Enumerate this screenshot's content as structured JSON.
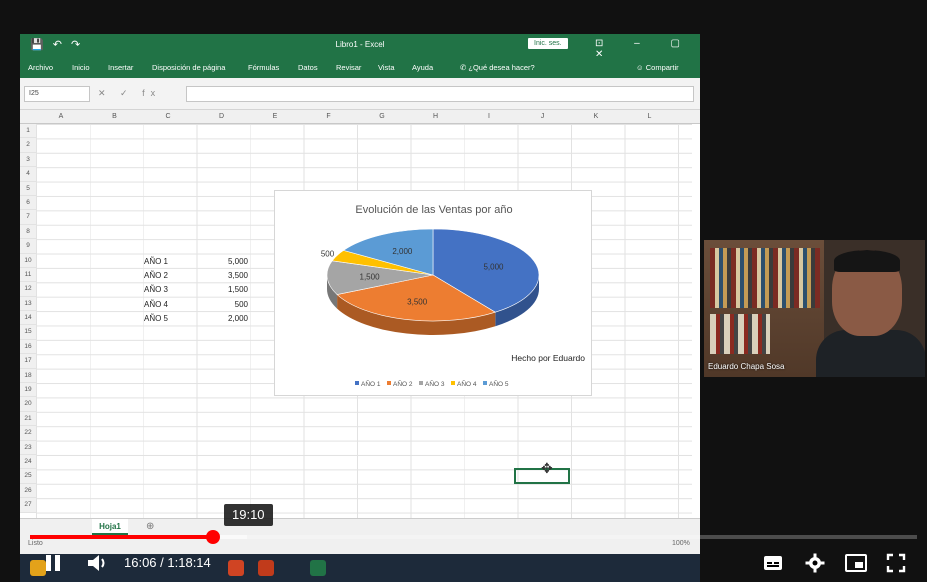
{
  "excel": {
    "quick_access": "💾 ↶ ↷",
    "title": "Libro1 - Excel",
    "signin_label": "Inic. ses.",
    "ribbon_tabs": [
      "Archivo",
      "Inicio",
      "Insertar",
      "Disposición de página",
      "Fórmulas",
      "Datos",
      "Revisar",
      "Vista",
      "Ayuda"
    ],
    "tell_me": "¿Qué desea hacer?",
    "share_label": "Compartir",
    "name_box": "I25",
    "fx_icons": "✕ ✓ fx",
    "columns": [
      "A",
      "B",
      "C",
      "D",
      "E",
      "F",
      "G",
      "H",
      "I",
      "J",
      "K",
      "L"
    ],
    "rows": [
      "1",
      "2",
      "3",
      "4",
      "5",
      "6",
      "7",
      "8",
      "9",
      "10",
      "11",
      "12",
      "13",
      "14",
      "15",
      "16",
      "17",
      "18",
      "19",
      "20",
      "21",
      "22",
      "23",
      "24",
      "25",
      "26",
      "27"
    ],
    "table": [
      {
        "label": "AÑO 1",
        "value": "5,000"
      },
      {
        "label": "AÑO 2",
        "value": "3,500"
      },
      {
        "label": "AÑO 3",
        "value": "1,500"
      },
      {
        "label": "AÑO 4",
        "value": "500"
      },
      {
        "label": "AÑO 5",
        "value": "2,000"
      }
    ],
    "sheet_tab": "Hoja1",
    "add_sheet": "⊕",
    "status_left": "Listo",
    "zoom": "100%"
  },
  "chart_data": {
    "type": "pie",
    "title": "Evolución de las Ventas por año",
    "annotation": "Hecho por Eduardo",
    "categories": [
      "AÑO 1",
      "AÑO 2",
      "AÑO 3",
      "AÑO 4",
      "AÑO 5"
    ],
    "values": [
      5000,
      3500,
      1500,
      500,
      2000
    ],
    "data_labels": [
      "5,000",
      "3,500",
      "1,500",
      "500",
      "2,000"
    ],
    "colors": [
      "#4472c4",
      "#ed7d31",
      "#a5a5a5",
      "#ffc000",
      "#5b9bd5"
    ],
    "legend_position": "bottom"
  },
  "webcam": {
    "name": "Eduardo Chapa Sosa"
  },
  "player": {
    "current_time": "16:06",
    "duration": "1:18:14",
    "time_separator": " / ",
    "hover_time": "19:10",
    "played_fraction": 0.206,
    "buffered_fraction": 0.245,
    "accent": "#ff0000"
  }
}
